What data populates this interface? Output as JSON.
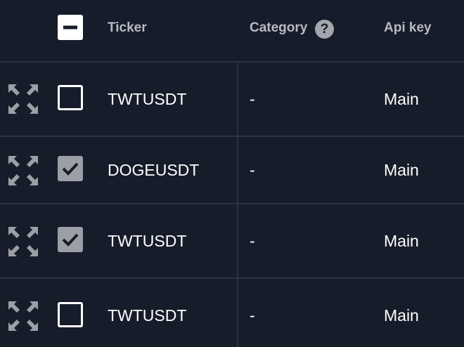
{
  "header": {
    "select_all_state": "indeterminate",
    "ticker_label": "Ticker",
    "category_label": "Category",
    "category_help_glyph": "?",
    "api_key_label": "Api key"
  },
  "rows": [
    {
      "checked": false,
      "ticker": "TWTUSDT",
      "category": "-",
      "api_key": "Main"
    },
    {
      "checked": true,
      "ticker": "DOGEUSDT",
      "category": "-",
      "api_key": "Main"
    },
    {
      "checked": true,
      "ticker": "TWTUSDT",
      "category": "-",
      "api_key": "Main"
    },
    {
      "checked": false,
      "ticker": "TWTUSDT",
      "category": "-",
      "api_key": "Main"
    }
  ],
  "icons": {
    "expand": "expand-arrows-icon",
    "help": "question-circle-icon",
    "check": "check-icon",
    "minus": "minus-icon"
  },
  "colors": {
    "background": "#171c2a",
    "divider": "#2c3240",
    "header_text": "#b7bac2",
    "cell_text": "#ffffff",
    "icon_gray": "#9d9fa6"
  }
}
